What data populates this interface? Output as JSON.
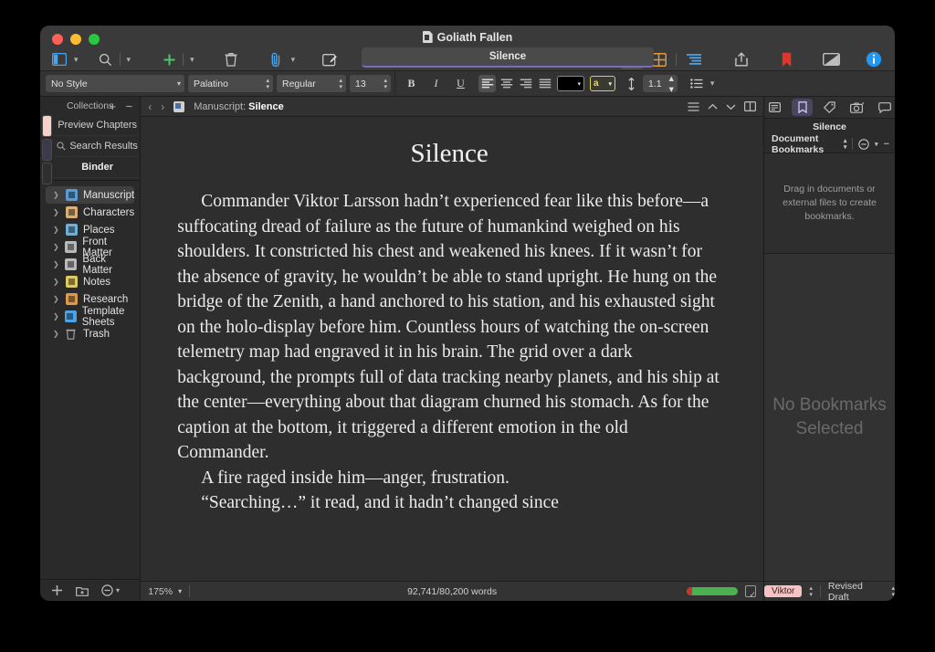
{
  "window": {
    "title": "Goliath Fallen",
    "title_icon": "document-icon",
    "traffic_lights": [
      "close",
      "minimize",
      "zoom"
    ]
  },
  "toolbar": {
    "left_buttons": [
      {
        "name": "view-layout-button",
        "icon": "sidebar-icon",
        "label": ""
      },
      {
        "name": "view-layout-menu",
        "icon": "chevron-down-icon",
        "label": "⌄"
      },
      {
        "name": "search-button",
        "icon": "search-icon",
        "label": ""
      },
      {
        "name": "search-menu",
        "icon": "chevron-down-icon",
        "label": "⌄"
      },
      {
        "name": "add-button",
        "icon": "plus-icon",
        "label": "+"
      },
      {
        "name": "add-menu",
        "icon": "chevron-down-icon",
        "label": "⌄"
      },
      {
        "name": "delete-button",
        "icon": "trash-icon",
        "label": ""
      },
      {
        "name": "attach-button",
        "icon": "paperclip-icon",
        "label": ""
      },
      {
        "name": "attach-menu",
        "icon": "chevron-down-icon",
        "label": "⌄"
      },
      {
        "name": "compose-button",
        "icon": "compose-icon",
        "label": ""
      }
    ],
    "title_field_value": "Silence",
    "right_buttons": [
      {
        "name": "copyholder-button",
        "icon": "copyholder-icon"
      },
      {
        "name": "corkboard-button",
        "icon": "corkboard-icon"
      },
      {
        "name": "outline-button",
        "icon": "outline-icon"
      },
      {
        "name": "share-button",
        "icon": "share-icon"
      },
      {
        "name": "bookmark-button",
        "icon": "bookmark-icon"
      },
      {
        "name": "composition-mode-button",
        "icon": "composition-mode-icon"
      },
      {
        "name": "inspector-button",
        "icon": "info-icon"
      }
    ]
  },
  "formatbar": {
    "style": "No Style",
    "font_family": "Palatino",
    "font_style": "Regular",
    "font_size": "13",
    "bold": "B",
    "italic": "I",
    "underline": "U",
    "align": [
      "align-left",
      "align-center",
      "align-right",
      "align-justify"
    ],
    "text_color": "#000000",
    "highlight_letter": "a",
    "highlight_color": "#e8dd5a",
    "line_spacing": "1.1",
    "list_icon": "list-icon"
  },
  "sidebar": {
    "collections_header": "Collections",
    "add_collection": "+",
    "remove_collection": "−",
    "collection_tabs": [
      {
        "name": "collection-tab-preview-chapters",
        "color": "#f7cfcb"
      },
      {
        "name": "collection-tab-search-results",
        "color": "#3b3b4c"
      },
      {
        "name": "collection-tab-binder",
        "color": "#2f2f2f"
      }
    ],
    "collections": [
      {
        "label": "Preview Chapters",
        "icon": "",
        "bold": false
      },
      {
        "label": "Search Results",
        "icon": "search-icon",
        "bold": false
      },
      {
        "label": "Binder",
        "icon": "",
        "bold": true
      }
    ],
    "items": [
      {
        "label": "Manuscript",
        "icon": "manuscript-folder-icon",
        "color": "#5b9bd5",
        "selected": true
      },
      {
        "label": "Characters",
        "icon": "characters-folder-icon",
        "color": "#d8b07a",
        "selected": false
      },
      {
        "label": "Places",
        "icon": "places-folder-icon",
        "color": "#6fb0d8",
        "selected": false
      },
      {
        "label": "Front Matter",
        "icon": "front-matter-folder-icon",
        "color": "#b9b9b9",
        "selected": false
      },
      {
        "label": "Back Matter",
        "icon": "back-matter-folder-icon",
        "color": "#b9b9b9",
        "selected": false
      },
      {
        "label": "Notes",
        "icon": "notes-folder-icon",
        "color": "#e0c967",
        "selected": false
      },
      {
        "label": "Research",
        "icon": "research-folder-icon",
        "color": "#d99a4e",
        "selected": false
      },
      {
        "label": "Template Sheets",
        "icon": "template-sheets-folder-icon",
        "color": "#4da3e8",
        "selected": false
      },
      {
        "label": "Trash",
        "icon": "trash-icon",
        "color": "#a8a8a8",
        "selected": false
      }
    ],
    "footer_buttons": [
      {
        "name": "add-item-button",
        "icon": "plus-icon",
        "label": "+"
      },
      {
        "name": "add-folder-button",
        "icon": "new-folder-icon",
        "label": ""
      },
      {
        "name": "view-options-button",
        "icon": "options-icon",
        "label": ""
      }
    ]
  },
  "editor": {
    "back_arrow": "‹",
    "forward_arrow": "›",
    "breadcrumb_prefix": "Manuscript:",
    "breadcrumb_current": "Silence",
    "header_icons": [
      {
        "name": "document-view-icon"
      },
      {
        "name": "previous-document-icon"
      },
      {
        "name": "next-document-icon"
      },
      {
        "name": "split-view-icon"
      }
    ],
    "doc_title": "Silence",
    "paragraphs": [
      "Commander Viktor Larsson hadn’t experienced fear like this before—a suffocating dread of failure as the future of humankind weighed on his shoulders. It constricted his chest and weakened his knees. If it wasn’t for the absence of gravity, he wouldn’t be able to stand upright. He hung on the bridge of the Zenith, a hand anchored to his station, and his exhausted sight on the holo-display before him. Countless hours of watching the on-screen telemetry map had engraved it in his brain. The grid over a dark background, the prompts full of data tracking nearby planets, and his ship at the center—everything about that diagram churned his stomach. As for the caption at the bottom, it triggered a different emotion in the old Commander.",
      "A fire raged inside him—anger, frustration.",
      "“Searching…” it read, and it hadn’t changed since"
    ],
    "footer": {
      "zoom": "175%",
      "word_count": "92,741/80,200 words",
      "progress_percent": 100,
      "progress_color": "#4cb050",
      "target_icon": "target-icon"
    }
  },
  "inspector": {
    "tabs": [
      {
        "name": "notes-tab",
        "icon": "notes-icon",
        "active": false
      },
      {
        "name": "bookmarks-tab",
        "icon": "bookmark-icon",
        "active": true
      },
      {
        "name": "metadata-tab",
        "icon": "tag-icon",
        "active": false
      },
      {
        "name": "snapshots-tab",
        "icon": "camera-icon",
        "active": false
      },
      {
        "name": "comments-tab",
        "icon": "comment-icon",
        "active": false
      }
    ],
    "title": "Silence",
    "section_label": "Document Bookmarks",
    "drop_hint": "Drag in documents or external files to create bookmarks.",
    "empty_state": "No Bookmarks Selected",
    "footer": {
      "label_badge": "Viktor",
      "badge_color": "#f6c2c2",
      "status": "Revised Draft"
    }
  }
}
